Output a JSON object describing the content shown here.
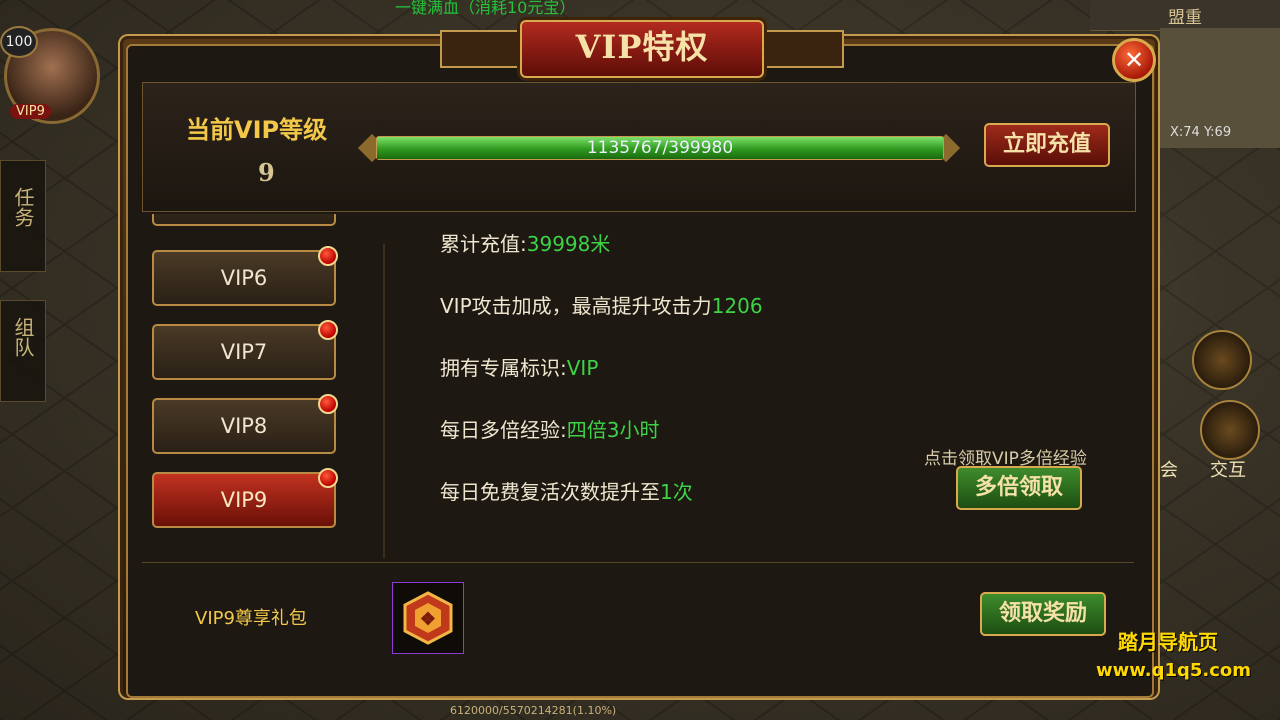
{
  "hud": {
    "top_text": "一键满血（消耗10元宝）",
    "player_level": "100",
    "player_vip": "VIP9",
    "top_right_label": "盟重",
    "minimap_coords": "X:74 Y:69",
    "side_tasks": "任务",
    "side_team": "组队",
    "right_labels": [
      "交互",
      "会"
    ],
    "bottom_exp": "6120000/5570214281(1.10%)"
  },
  "dialog": {
    "title": "VIP特权",
    "close_icon": "close-x",
    "current_level_label": "当前VIP等级",
    "current_level_value": "9",
    "progress": {
      "text": "1135767/399980",
      "fraction": 1.0
    },
    "recharge_button": "立即充值"
  },
  "vip_list": [
    "VIP6",
    "VIP7",
    "VIP8",
    "VIP9"
  ],
  "vip_list_selected": "VIP9",
  "details": {
    "row1_label": "累计充值:",
    "row1_value": "39998米",
    "row2_label": "VIP攻击加成，最高提升攻击力",
    "row2_value": "1206",
    "row3_label": "拥有专属标识:",
    "row3_value": "VIP",
    "row4_label": "每日多倍经验:",
    "row4_value": "四倍3小时",
    "row5_label": "每日免费复活次数提升至",
    "row5_value": "1次"
  },
  "multi_exp": {
    "hint": "点击领取VIP多倍经验",
    "button": "多倍领取"
  },
  "reward": {
    "label": "VIP9尊享礼包",
    "item_icon": "gift-pack-icon",
    "button": "领取奖励"
  },
  "watermark": {
    "line1": "踏月导航页",
    "line2": "www.q1q5.com"
  },
  "colors": {
    "accent_gold": "#d9a94d",
    "green_value": "#3ed346",
    "title_red": "#b22a1e"
  }
}
